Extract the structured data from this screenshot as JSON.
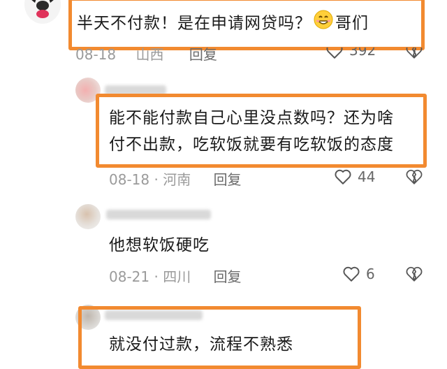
{
  "comments": [
    {
      "text": "半天不付款！是在申请网贷吗？",
      "text_suffix": "哥们",
      "emoji": "grinning-face",
      "date": "08-18",
      "location": "山西",
      "reply": "回复",
      "likes": "392"
    },
    {
      "lines": [
        "能不能付款自己心里没点数吗？还为啥",
        "付不出款，吃软饭就要有吃软饭的态度"
      ],
      "date": "08-18",
      "separator": "·",
      "location": "河南",
      "reply": "回复",
      "likes": "44"
    },
    {
      "text": "他想软饭硬吃",
      "date": "08-21",
      "separator": "·",
      "location": "四川",
      "reply": "回复",
      "likes": "6"
    },
    {
      "text": "就没付过款，流程不熟悉"
    }
  ],
  "colors": {
    "highlight_border": "#f28a30",
    "meta_gray": "#9a9a9a"
  }
}
